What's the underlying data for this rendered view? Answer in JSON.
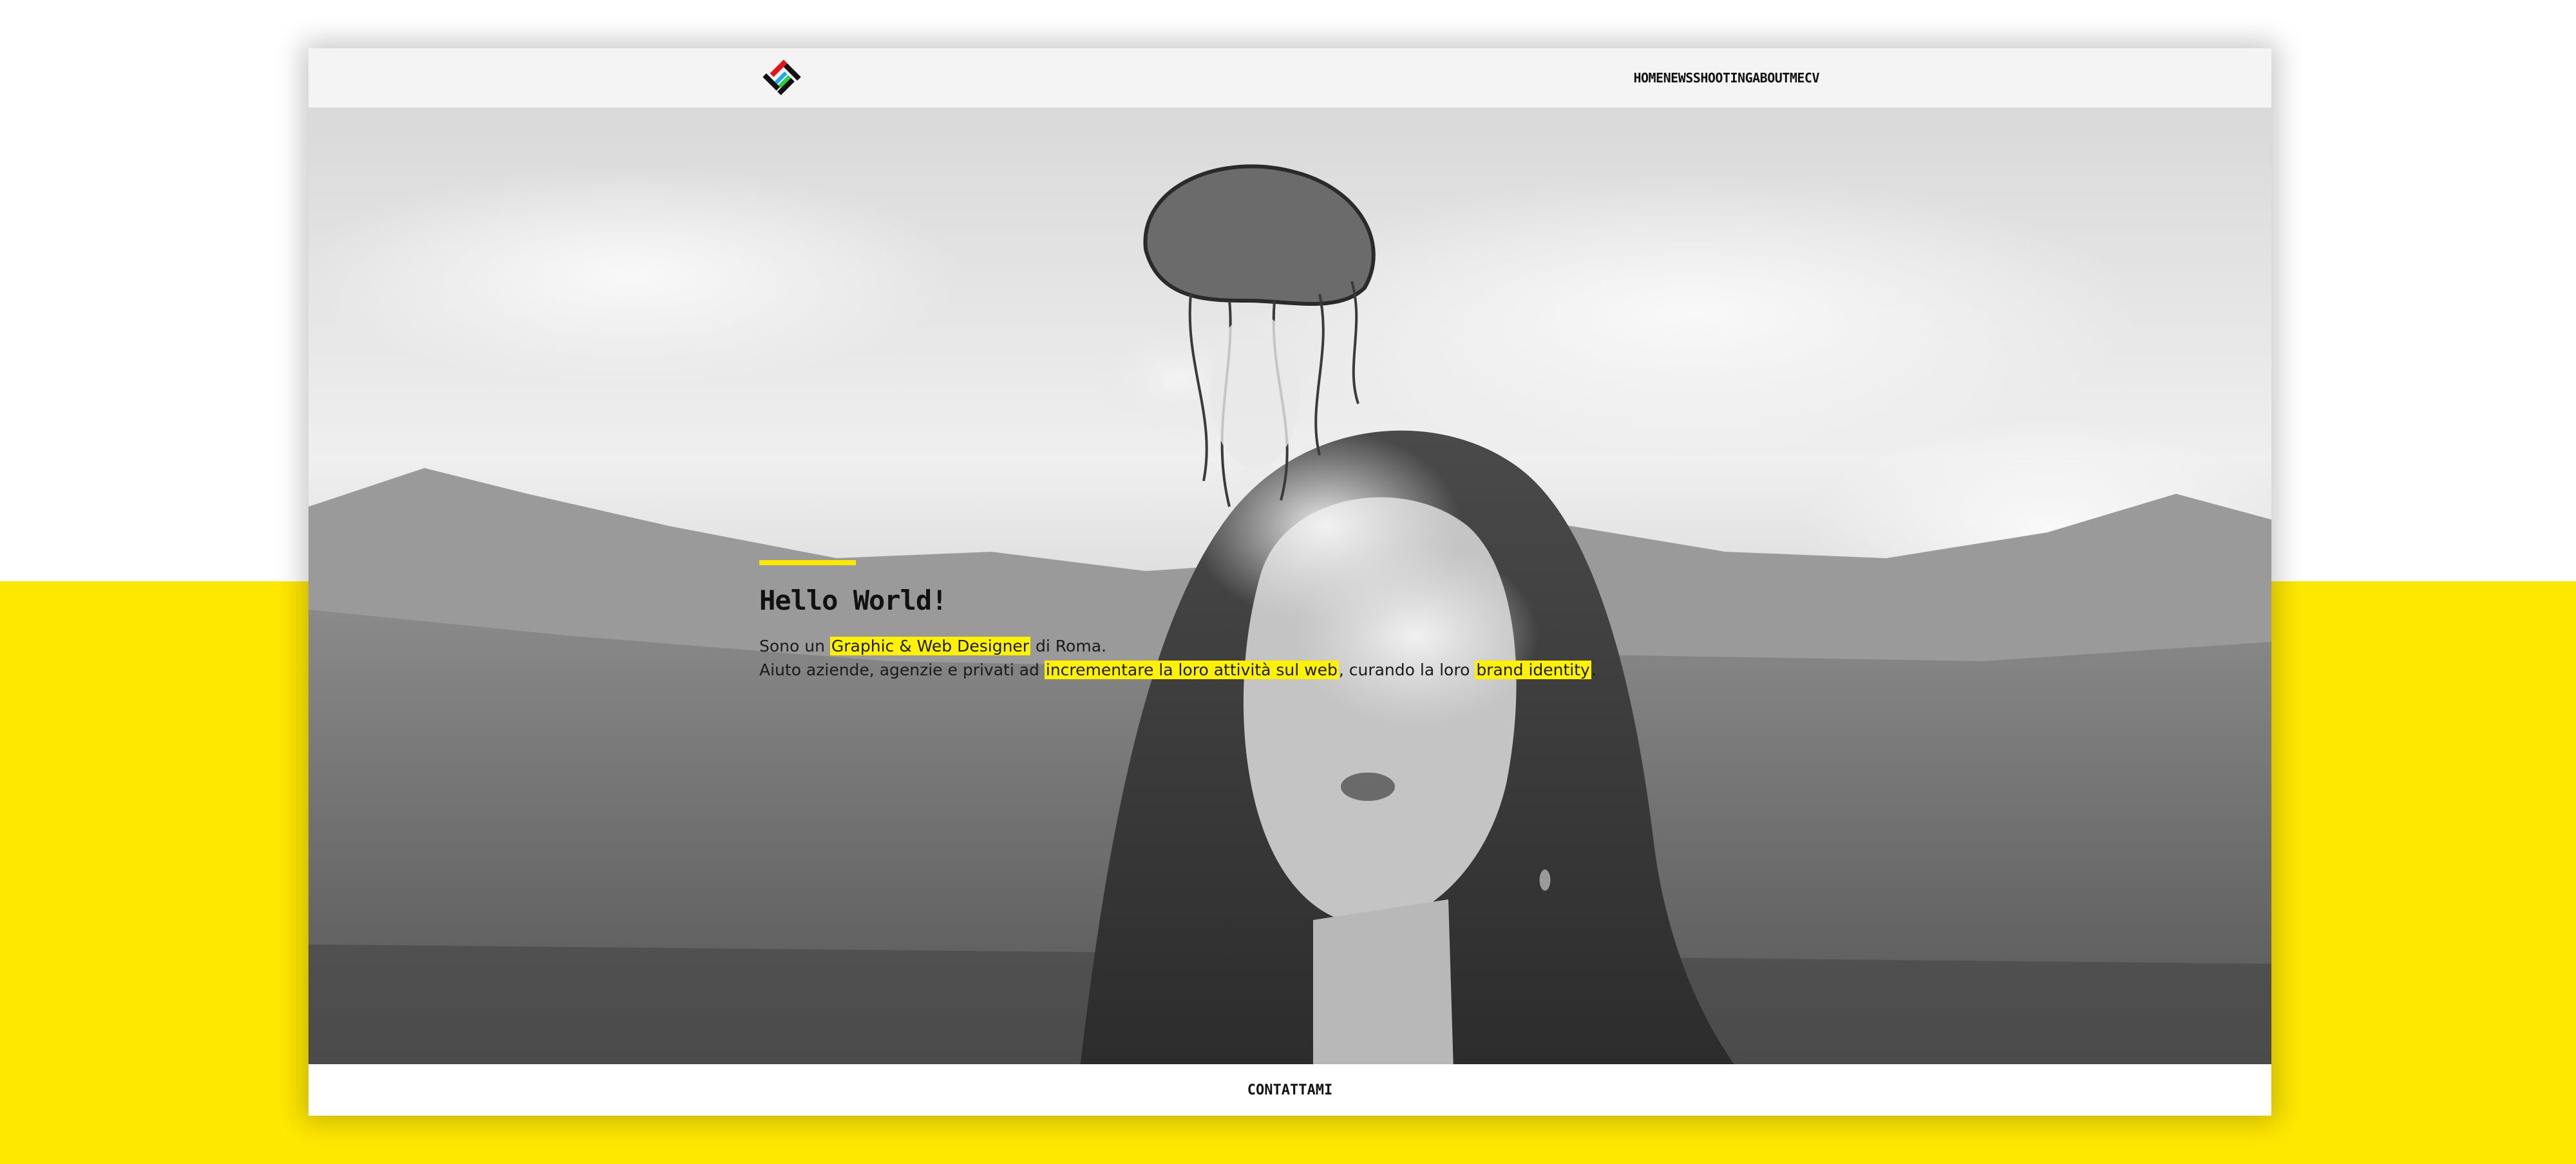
{
  "colors": {
    "accent_yellow": "#ffe800",
    "highlight_yellow": "#fff200",
    "text": "#111111"
  },
  "header": {
    "logo_icon": "diamond-logo-icon",
    "nav": [
      "HOME",
      "NEWS",
      "SHOOTING",
      "ABOUTME",
      "CV"
    ]
  },
  "hero": {
    "background_image": "woman-blowing-smoke-jellyfish-photo",
    "title": "Hello World!",
    "line1_prefix": "Sono un ",
    "line1_highlight": "Graphic & Web Designer",
    "line1_suffix": " di Roma.",
    "line2_prefix": "Aiuto aziende, agenzie e privati ad ",
    "line2_highlight1": "incrementare la loro attività sul web",
    "line2_middle": ", curando la loro ",
    "line2_highlight2": "brand identity",
    "line2_suffix": "."
  },
  "footer": {
    "contact_label": "CONTATTAMI"
  }
}
